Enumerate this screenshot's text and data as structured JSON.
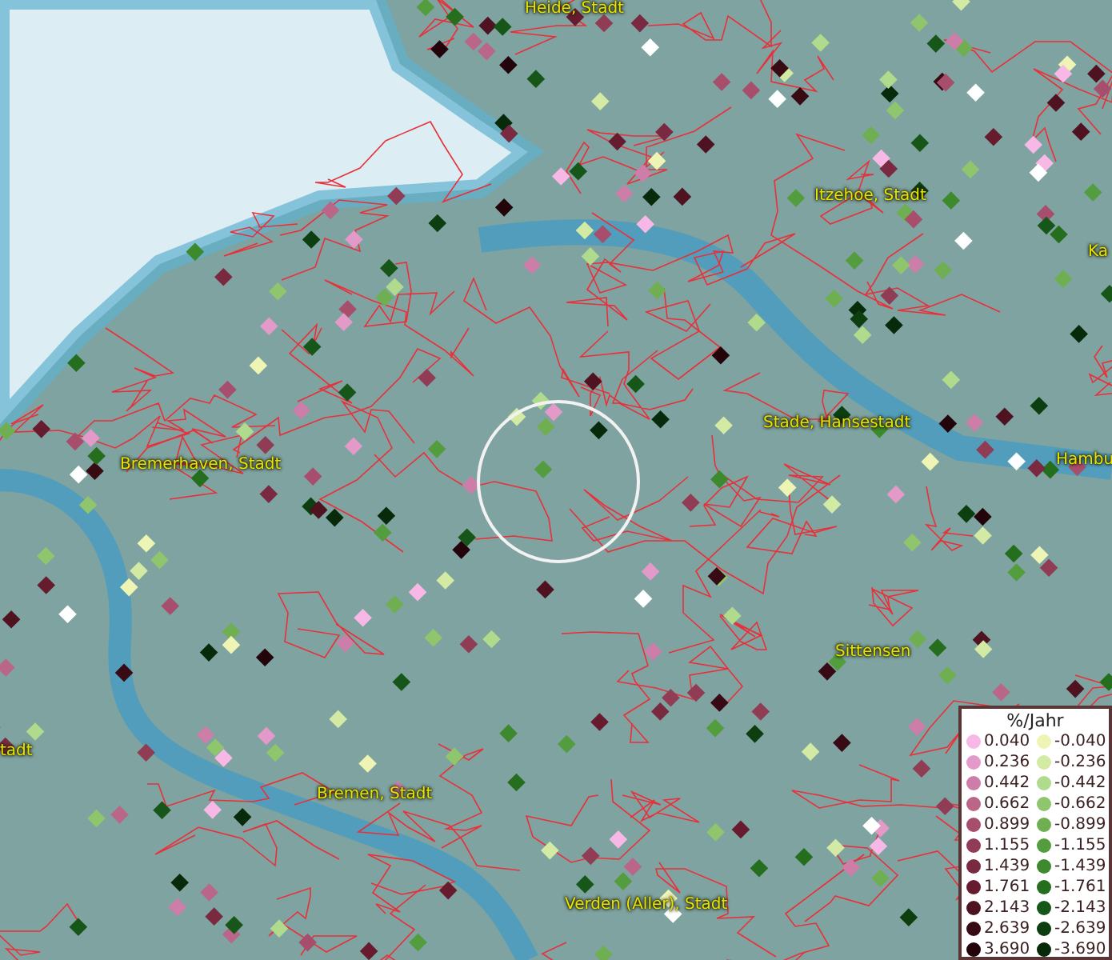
{
  "map": {
    "place_labels": [
      {
        "text": "Heide, Stadt"
      },
      {
        "text": "Itzehoe, Stadt"
      },
      {
        "text": "Ka"
      },
      {
        "text": "Stade, Hansestadt"
      },
      {
        "text": "Hambu"
      },
      {
        "text": "Bremerhaven, Stadt"
      },
      {
        "text": "Sittensen"
      },
      {
        "text": "tadt"
      },
      {
        "text": "Bremen, Stadt"
      },
      {
        "text": "Verden (Aller), Stadt"
      }
    ]
  },
  "legend": {
    "title": "%/Jahr",
    "rows": [
      {
        "positive": {
          "label": "0.040",
          "color": "#f7b8e6"
        },
        "negative": {
          "label": "-0.040",
          "color": "#eef5b4"
        }
      },
      {
        "positive": {
          "label": "0.236",
          "color": "#e39ac8"
        },
        "negative": {
          "label": "-0.236",
          "color": "#d2eaa4"
        }
      },
      {
        "positive": {
          "label": "0.442",
          "color": "#cc7ea8"
        },
        "negative": {
          "label": "-0.442",
          "color": "#b0da8c"
        }
      },
      {
        "positive": {
          "label": "0.662",
          "color": "#ba6688"
        },
        "negative": {
          "label": "-0.662",
          "color": "#8fc56c"
        }
      },
      {
        "positive": {
          "label": "0.899",
          "color": "#a64e6c"
        },
        "negative": {
          "label": "-0.899",
          "color": "#70ae52"
        }
      },
      {
        "positive": {
          "label": "1.155",
          "color": "#913c55"
        },
        "negative": {
          "label": "-1.155",
          "color": "#539d3e"
        }
      },
      {
        "positive": {
          "label": "1.439",
          "color": "#7a2a40"
        },
        "negative": {
          "label": "-1.439",
          "color": "#3d8a2e"
        }
      },
      {
        "positive": {
          "label": "1.761",
          "color": "#661c2e"
        },
        "negative": {
          "label": "-1.761",
          "color": "#256e1e"
        }
      },
      {
        "positive": {
          "label": "2.143",
          "color": "#4e1220"
        },
        "negative": {
          "label": "-2.143",
          "color": "#165618"
        }
      },
      {
        "positive": {
          "label": "2.639",
          "color": "#380a14"
        },
        "negative": {
          "label": "-2.639",
          "color": "#0c3e10"
        }
      },
      {
        "positive": {
          "label": "3.690",
          "color": "#22040a"
        },
        "negative": {
          "label": "-3.690",
          "color": "#062a0a"
        }
      }
    ]
  }
}
